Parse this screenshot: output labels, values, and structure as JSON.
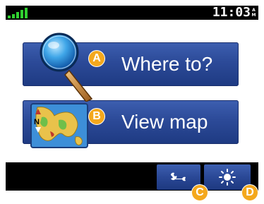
{
  "status_bar": {
    "time": "11:03",
    "ampm_top": "A",
    "ampm_bottom": "M",
    "signal_bars": 5,
    "signal_color": "#30d030"
  },
  "main_menu": {
    "where_to": {
      "label": "Where to?",
      "callout": "A",
      "icon": "magnifier-icon"
    },
    "view_map": {
      "label": "View map",
      "callout": "B",
      "icon": "map-icon"
    }
  },
  "bottom_bar": {
    "tools": {
      "icon": "wrench-icon",
      "callout": "C"
    },
    "brightness": {
      "icon": "brightness-icon",
      "callout": "D"
    }
  },
  "colors": {
    "button_blue": "#2c4a98",
    "callout_orange": "#f4a81d",
    "bar_black": "#000000"
  }
}
